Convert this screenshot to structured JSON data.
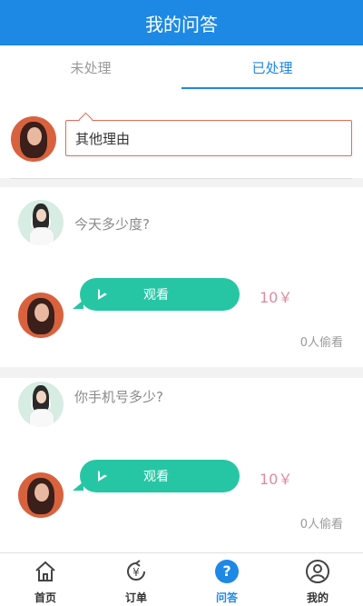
{
  "header": {
    "title": "我的问答"
  },
  "tabs": [
    {
      "label": "未处理"
    },
    {
      "label": "已处理"
    }
  ],
  "reason": {
    "text": "其他理由"
  },
  "items": [
    {
      "question": "今天多少度?",
      "watch_label": "观看",
      "price": "10￥",
      "peek": "0人偷看"
    },
    {
      "question": "你手机号多少?",
      "watch_label": "观看",
      "price": "10￥",
      "peek": "0人偷看"
    }
  ],
  "bottom_nav": [
    {
      "label": "首页",
      "icon": "home-icon"
    },
    {
      "label": "订单",
      "icon": "order-icon"
    },
    {
      "label": "问答",
      "icon": "question-icon"
    },
    {
      "label": "我的",
      "icon": "profile-icon"
    }
  ],
  "colors": {
    "primary": "#1e88e5",
    "bubble": "#26c6a4",
    "price": "#e08a9f",
    "reason_border": "#e06b5a"
  }
}
